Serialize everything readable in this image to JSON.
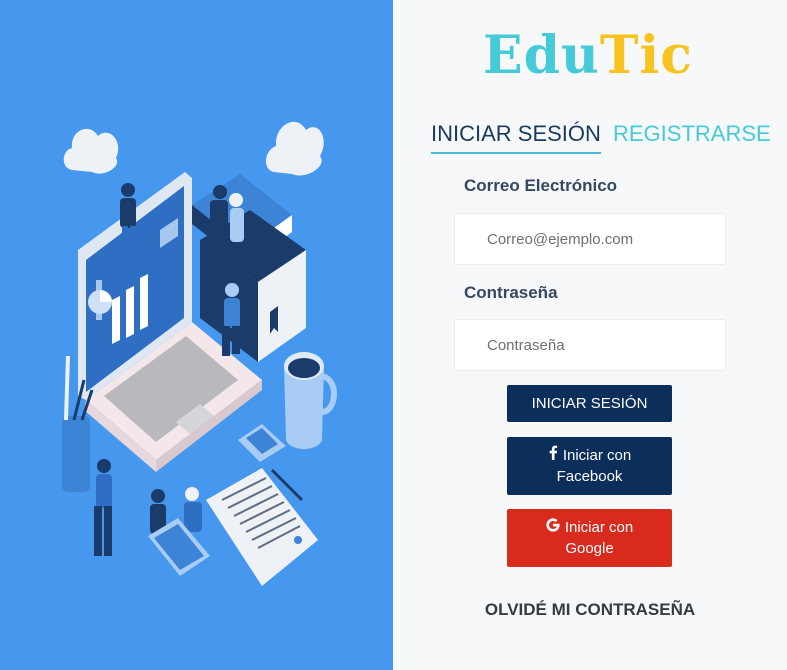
{
  "brand": {
    "name_part1": "Edu",
    "name_part2": "Tic",
    "color_part1": "#45cbd8",
    "color_part2": "#f7c31e"
  },
  "tabs": {
    "login": "INICIAR SESIÓN",
    "register": "REGISTRARSE"
  },
  "form": {
    "email_label": "Correo Electrónico",
    "email_placeholder": "Correo@ejemplo.com",
    "password_label": "Contraseña",
    "password_placeholder": "Contraseña"
  },
  "buttons": {
    "login": "INICIAR SESIÓN",
    "facebook_line1": "Iniciar con",
    "facebook_line2": "Facebook",
    "facebook_icon": "facebook-icon",
    "google_line1": "Iniciar con",
    "google_line2": "Google",
    "google_icon": "google-icon"
  },
  "forgot_password": "OLVIDÉ MI CONTRASEÑA",
  "colors": {
    "left_panel": "#4697ee",
    "primary_button": "#0b2e5b",
    "google_button": "#d92a1e",
    "accent": "#45cbd8"
  },
  "illustration": "laptop-education-illustration"
}
